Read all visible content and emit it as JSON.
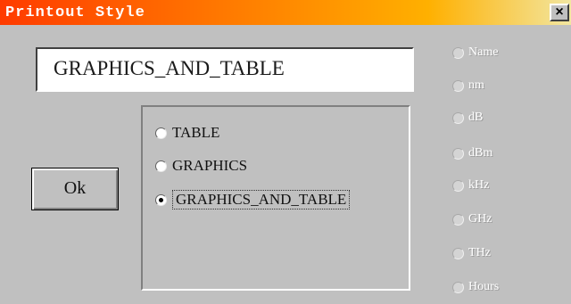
{
  "window": {
    "title": "Printout Style",
    "close_label": "×"
  },
  "style_display": {
    "value": "GRAPHICS_AND_TABLE"
  },
  "ok_button": {
    "label": "Ok"
  },
  "style_options": [
    {
      "label": "TABLE",
      "checked": false
    },
    {
      "label": "GRAPHICS",
      "checked": false
    },
    {
      "label": "GRAPHICS_AND_TABLE",
      "checked": true
    }
  ],
  "unit_options": [
    {
      "label": "Name",
      "enabled": false
    },
    {
      "label": "nm",
      "enabled": false
    },
    {
      "label": "dB",
      "enabled": false
    },
    {
      "label": "dBm",
      "enabled": false
    },
    {
      "label": "kHz",
      "enabled": false
    },
    {
      "label": "GHz",
      "enabled": false
    },
    {
      "label": "THz",
      "enabled": false
    },
    {
      "label": "Hours",
      "enabled": false
    }
  ]
}
